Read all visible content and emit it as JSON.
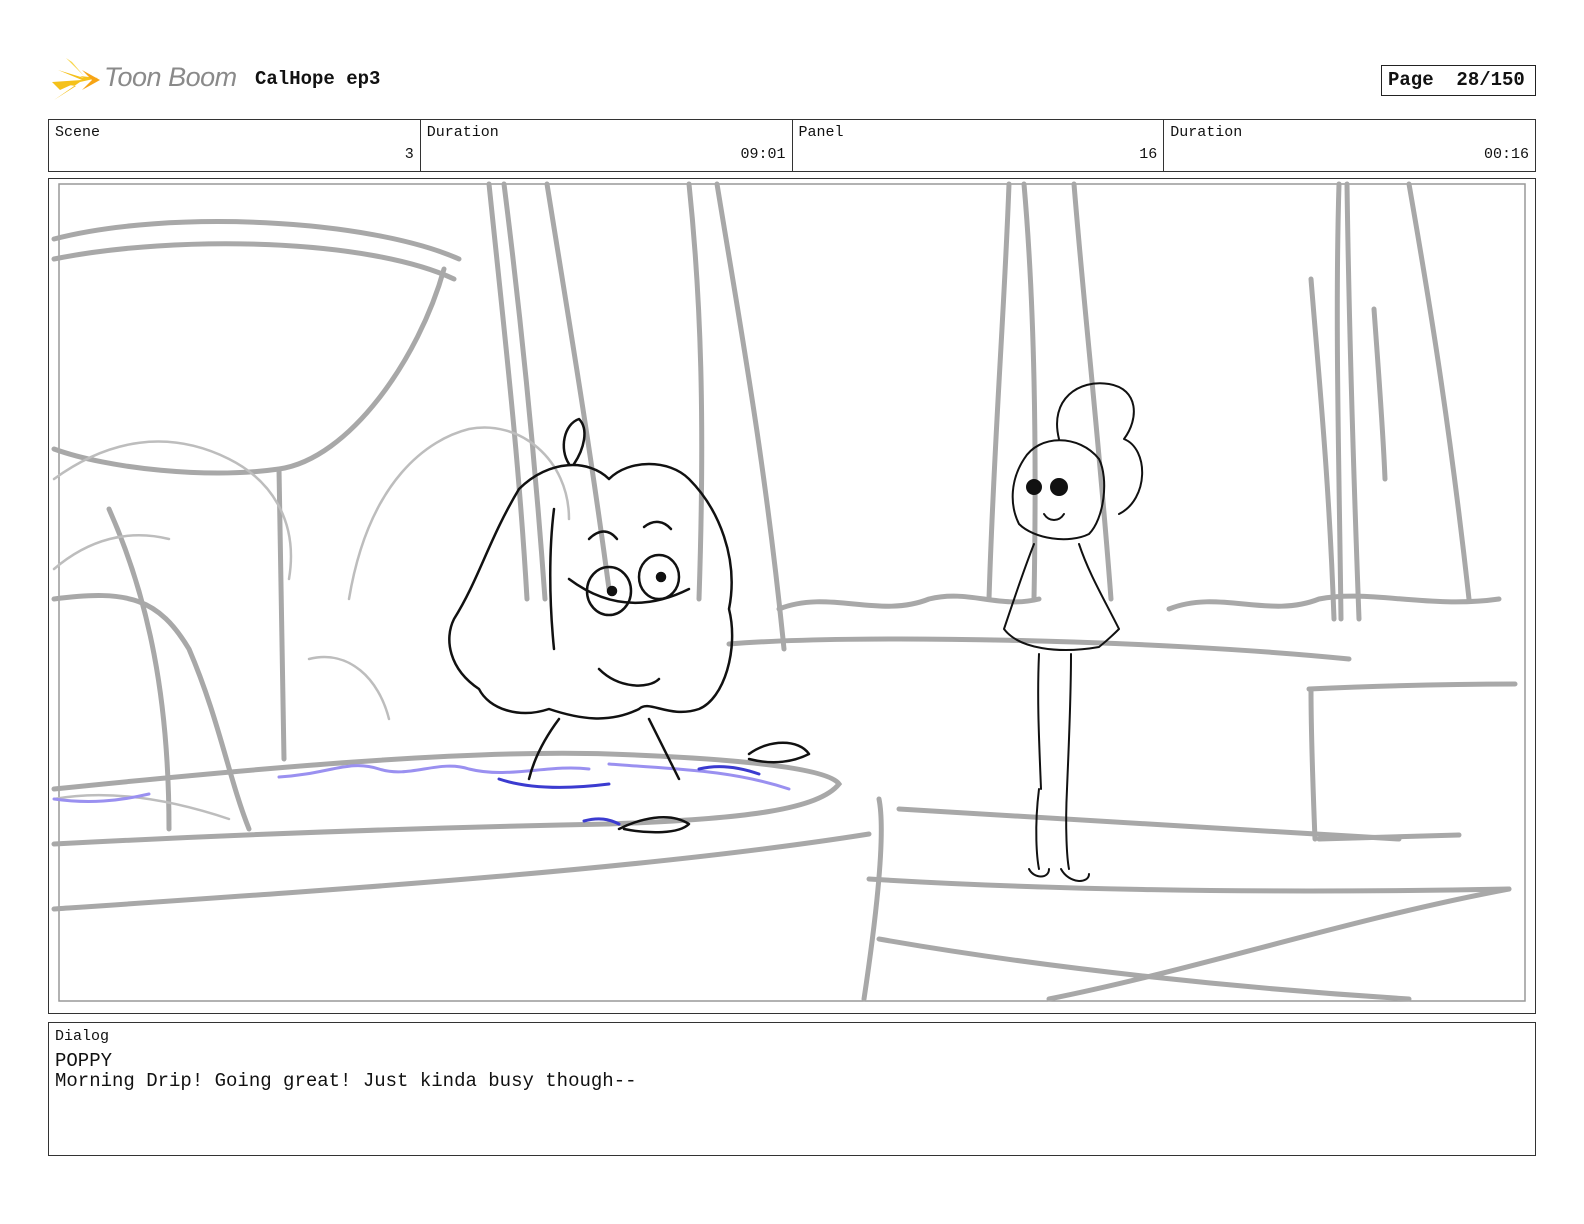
{
  "header": {
    "logo_text": "Toon Boom",
    "project_title": "CalHope ep3",
    "page_label": "Page",
    "page_value": "28/150"
  },
  "info": [
    {
      "label": "Scene",
      "value": "3"
    },
    {
      "label": "Duration",
      "value": "09:01"
    },
    {
      "label": "Panel",
      "value": "16"
    },
    {
      "label": "Duration",
      "value": "00:16"
    }
  ],
  "dialog": {
    "label": "Dialog",
    "speaker": "POPPY",
    "line": "Morning Drip! Going great! Just kinda busy though--"
  },
  "colors": {
    "sketch_gray": "#a8a8a8",
    "ink": "#111111",
    "water_purple": "#9a90f0",
    "water_blue": "#3b3bd0",
    "logo_yellow": "#f5c11a"
  }
}
